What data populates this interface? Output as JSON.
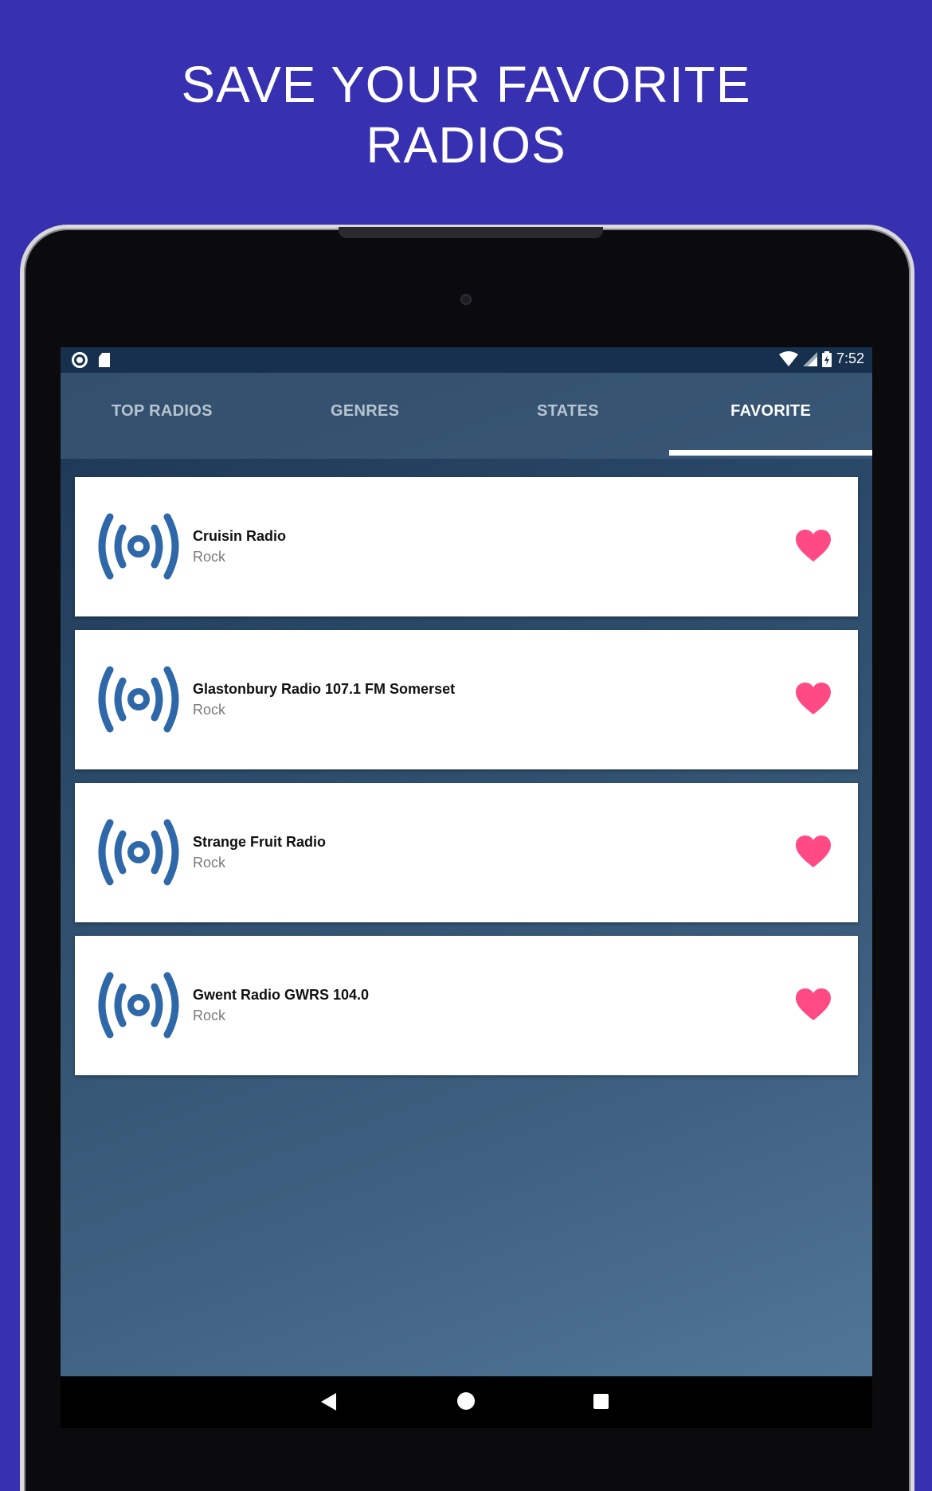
{
  "headline": {
    "line1": "SAVE YOUR FAVORITE",
    "line2": "RADIOS"
  },
  "status_bar": {
    "time": "7:52",
    "icons": [
      "record-icon",
      "sd-card-icon",
      "wifi-icon",
      "signal-icon",
      "battery-charging-icon"
    ]
  },
  "tabs": [
    {
      "label": "TOP RADIOS",
      "active": false
    },
    {
      "label": "GENRES",
      "active": false
    },
    {
      "label": "STATES",
      "active": false
    },
    {
      "label": "FAVORITE",
      "active": true
    }
  ],
  "stations": [
    {
      "name": "Cruisin Radio",
      "genre": "Rock"
    },
    {
      "name": "Glastonbury Radio 107.1 FM Somerset",
      "genre": "Rock"
    },
    {
      "name": "Strange Fruit Radio",
      "genre": "Rock"
    },
    {
      "name": "Gwent Radio GWRS 104.0",
      "genre": "Rock"
    }
  ],
  "nav": [
    "back-icon",
    "home-icon",
    "recents-icon"
  ],
  "colors": {
    "background": "#3730b0",
    "radio_icon": "#2f68a8",
    "heart": "#ff4a86",
    "status_bar": "#16304d"
  }
}
